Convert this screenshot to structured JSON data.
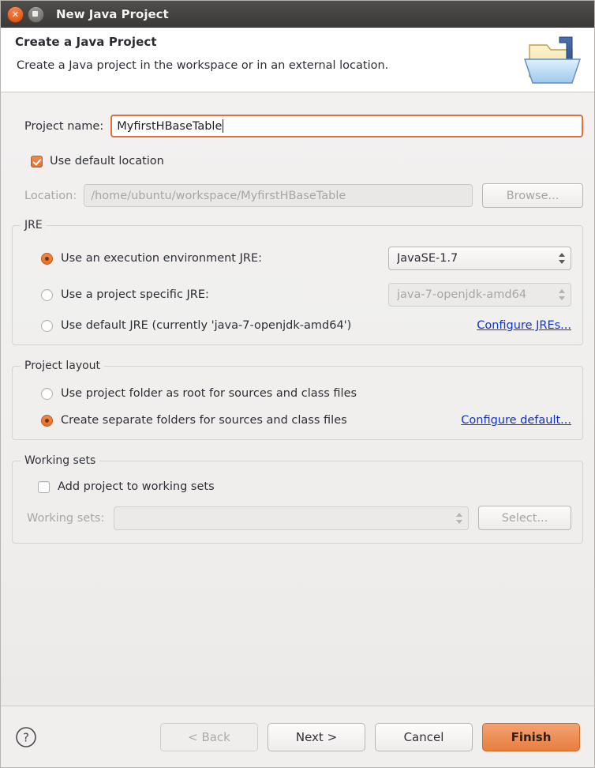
{
  "window": {
    "title": "New Java Project",
    "close_icon": "close-icon",
    "maximize_icon": "maximize-icon"
  },
  "header": {
    "title": "Create a Java Project",
    "description": "Create a Java project in the workspace or in an external location.",
    "icon": "java-project-folder-icon"
  },
  "project_name": {
    "label": "Project name:",
    "value": "MyfirstHBaseTable",
    "placeholder": ""
  },
  "use_default_location": {
    "label": "Use default location",
    "checked": true
  },
  "location": {
    "label": "Location:",
    "value": "/home/ubuntu/workspace/MyfirstHBaseTable",
    "browse_label": "Browse...",
    "enabled": false
  },
  "jre": {
    "group_title": "JRE",
    "options": [
      {
        "label": "Use an execution environment JRE:",
        "selected": true,
        "combo_value": "JavaSE-1.7",
        "combo_enabled": true
      },
      {
        "label": "Use a project specific JRE:",
        "selected": false,
        "combo_value": "java-7-openjdk-amd64",
        "combo_enabled": false
      },
      {
        "label": "Use default JRE (currently 'java-7-openjdk-amd64')",
        "selected": false
      }
    ],
    "configure_link": "Configure JREs..."
  },
  "project_layout": {
    "group_title": "Project layout",
    "options": [
      {
        "label": "Use project folder as root for sources and class files",
        "selected": false
      },
      {
        "label": "Create separate folders for sources and class files",
        "selected": true
      }
    ],
    "configure_link": "Configure default..."
  },
  "working_sets": {
    "group_title": "Working sets",
    "add_label": "Add project to working sets",
    "add_checked": false,
    "sets_label": "Working sets:",
    "sets_value": "",
    "select_label": "Select...",
    "enabled": false
  },
  "footer": {
    "help_icon": "help-icon",
    "back_label": "< Back",
    "next_label": "Next >",
    "cancel_label": "Cancel",
    "finish_label": "Finish"
  },
  "colors": {
    "accent_orange": "#e2702f",
    "link_blue": "#1032c8",
    "titlebar": "#3b3937",
    "background": "#f1efee"
  }
}
